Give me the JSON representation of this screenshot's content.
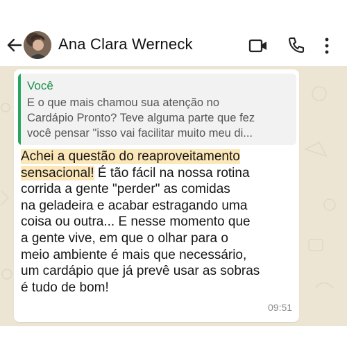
{
  "header": {
    "contact_name": "Ana Clara Werneck",
    "icons": [
      "back-arrow-icon",
      "video-call-icon",
      "phone-icon",
      "more-options-icon"
    ]
  },
  "message": {
    "quoted": {
      "author": "Você",
      "lines": [
        "E o que mais chamou sua atenção no",
        "Cardápio Pronto? Teve alguma parte que fez",
        "você pensar \"isso vai facilitar muito meu di..."
      ]
    },
    "highlighted_lines": [
      "Achei a questão do reaproveitamento",
      "sensacional!"
    ],
    "line2_rest": " É tão fácil na nossa rotina",
    "lines": [
      "corrida a gente \"perder\" as comidas",
      "na geladeira e acabar estragando uma",
      "coisa ou outra... E nesse momento que",
      "a gente vive, em que o olhar para o",
      "meio ambiente é mais que necessário,",
      "um cardápio que já prevê usar as sobras",
      "é tudo de bom!"
    ],
    "time": "09:51"
  },
  "colors": {
    "header_bg": "#ffffff",
    "chat_bg": "#ece5d4",
    "quote_accent": "#25a55f",
    "highlight": "#fbe7b8"
  }
}
